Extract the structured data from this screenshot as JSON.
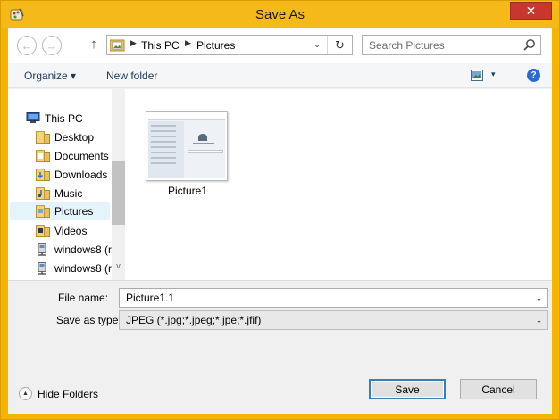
{
  "window": {
    "title": "Save As",
    "close_glyph": "✕",
    "accent": "#f6b91a",
    "close_color": "#c7372f"
  },
  "nav": {
    "back_glyph": "←",
    "forward_glyph": "→",
    "up_glyph": "↑",
    "breadcrumb": [
      "This PC",
      "Pictures"
    ],
    "breadcrumb_sep": "▶",
    "dropdown_glyph": "⌄",
    "refresh_glyph": "↻",
    "search_placeholder": "Search Pictures"
  },
  "toolbar": {
    "organize_label": "Organize ▾",
    "new_folder_label": "New folder",
    "view_caret": "▾",
    "help_glyph": "?"
  },
  "navpane": {
    "items": [
      {
        "label": "This PC",
        "icon": "computer-icon"
      },
      {
        "label": "Desktop",
        "icon": "folder-icon"
      },
      {
        "label": "Documents",
        "icon": "folder-icon"
      },
      {
        "label": "Downloads",
        "icon": "folder-download-icon"
      },
      {
        "label": "Music",
        "icon": "folder-music-icon"
      },
      {
        "label": "Pictures",
        "icon": "folder-icon",
        "selected": true
      },
      {
        "label": "Videos",
        "icon": "folder-icon"
      },
      {
        "label": "windows8 (r",
        "icon": "network-drive-icon"
      },
      {
        "label": "windows8 (r",
        "icon": "network-drive-icon"
      }
    ],
    "scroll_down_glyph": "v"
  },
  "files": [
    {
      "name": "Picture1"
    }
  ],
  "form": {
    "filename_label": "File name:",
    "filename_value": "Picture1.1",
    "type_label": "Save as type:",
    "type_value": "JPEG (*.jpg;*.jpeg;*.jpe;*.jfif)",
    "dropdown_glyph": "⌄"
  },
  "bottom": {
    "hide_folders_label": "Hide Folders",
    "hide_folders_glyph": "▲",
    "save_label": "Save",
    "cancel_label": "Cancel"
  }
}
